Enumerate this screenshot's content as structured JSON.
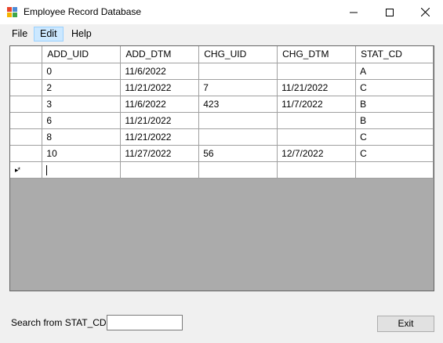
{
  "window": {
    "title": "Employee Record Database"
  },
  "menu": {
    "file": "File",
    "edit": "Edit",
    "help": "Help"
  },
  "grid": {
    "columns": [
      "ADD_UID",
      "ADD_DTM",
      "CHG_UID",
      "CHG_DTM",
      "STAT_CD"
    ],
    "rows": [
      [
        "0",
        "11/6/2022",
        "",
        "",
        "A"
      ],
      [
        "2",
        "11/21/2022",
        "7",
        "11/21/2022",
        "C"
      ],
      [
        "3",
        "11/6/2022",
        "423",
        "11/7/2022",
        "B"
      ],
      [
        "6",
        "11/21/2022",
        "",
        "",
        "B"
      ],
      [
        "8",
        "11/21/2022",
        "",
        "",
        "C"
      ],
      [
        "10",
        "11/27/2022",
        "56",
        "12/7/2022",
        "C"
      ]
    ],
    "new_row_marker": "▸*"
  },
  "search": {
    "label": "Search from STAT_CD:",
    "value": ""
  },
  "buttons": {
    "exit": "Exit"
  },
  "icons": {
    "app": "app-form-icon",
    "minimize": "minimize-icon",
    "maximize": "maximize-icon",
    "close": "close-icon"
  }
}
